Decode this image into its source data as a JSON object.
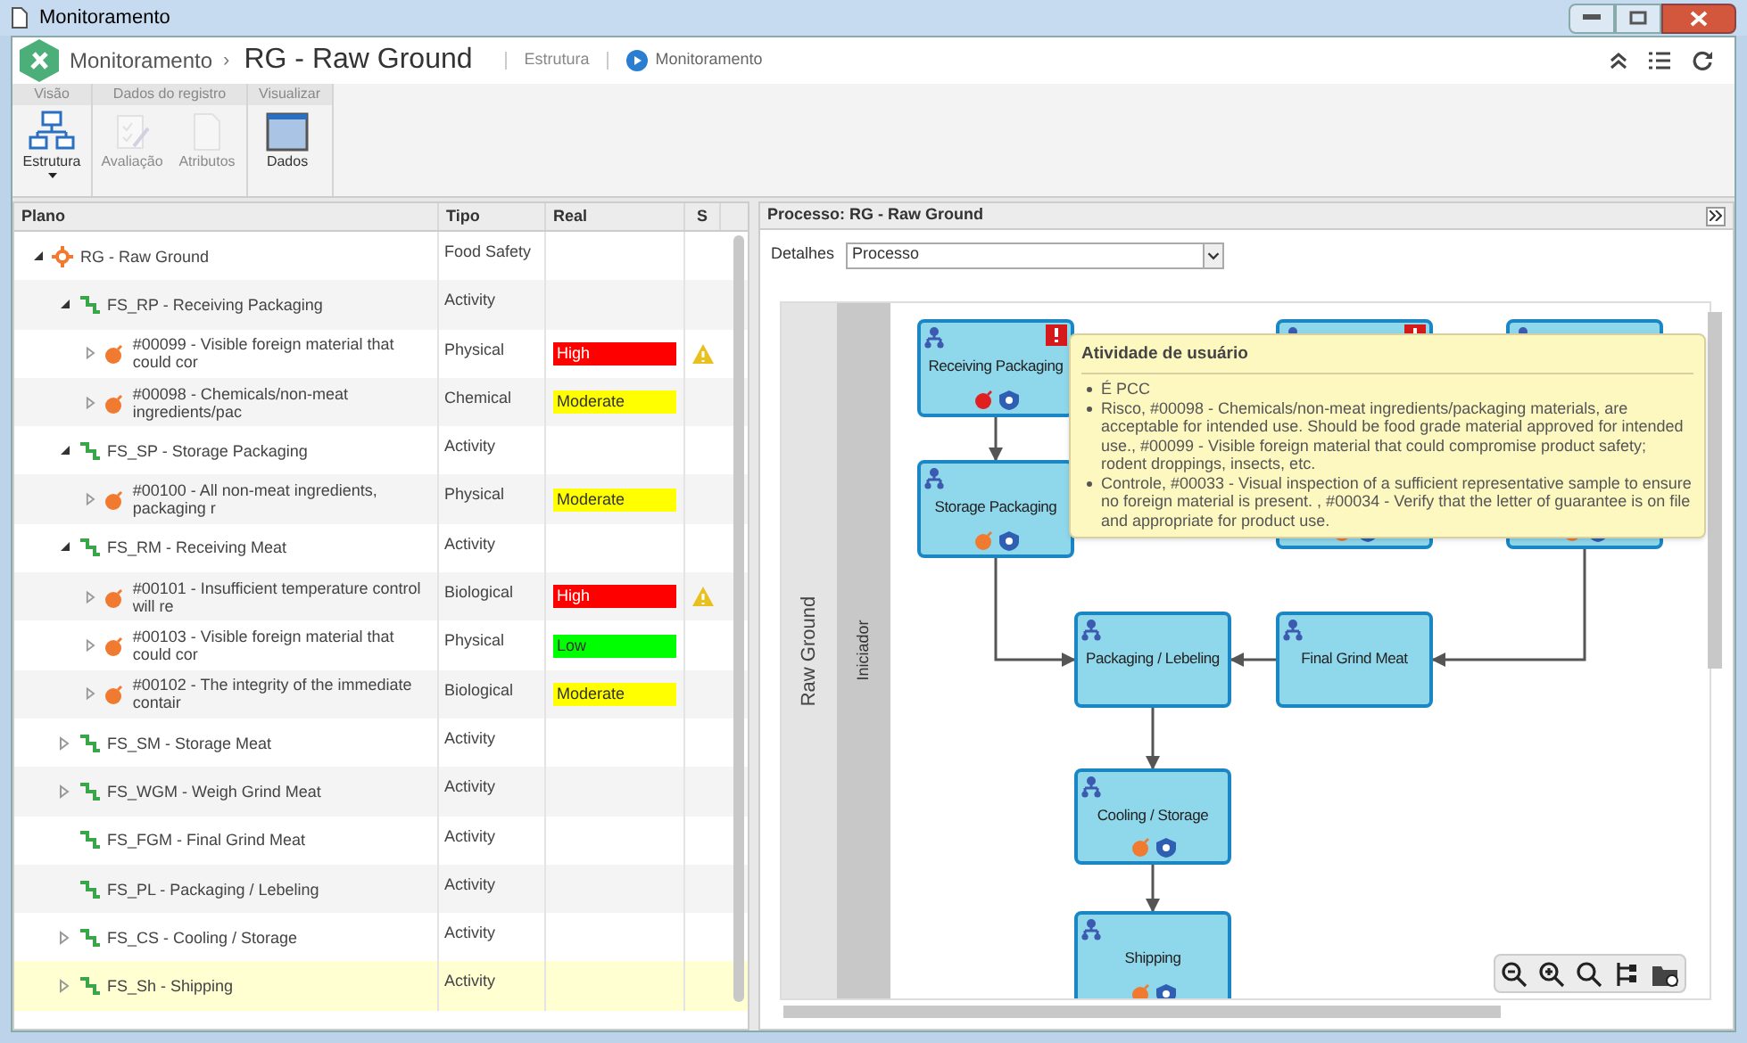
{
  "window": {
    "title": "Monitoramento"
  },
  "header": {
    "module": "Monitoramento",
    "separator": "›",
    "record": "RG - Raw Ground",
    "links": [
      {
        "label": "Estrutura",
        "current": false
      },
      {
        "label": "Monitoramento",
        "current": true
      }
    ]
  },
  "ribbon": {
    "groups": [
      {
        "label": "Visão",
        "buttons": [
          {
            "label": "Estrutura",
            "disabled": false,
            "dropdown": true
          }
        ]
      },
      {
        "label": "Dados do registro",
        "buttons": [
          {
            "label": "Avaliação",
            "disabled": true,
            "dropdown": false
          },
          {
            "label": "Atributos",
            "disabled": true,
            "dropdown": false
          }
        ]
      },
      {
        "label": "Visualizar",
        "buttons": [
          {
            "label": "Dados",
            "disabled": false,
            "dropdown": false
          }
        ]
      }
    ]
  },
  "tree": {
    "columns": [
      "Plano",
      "Tipo",
      "Real",
      "S"
    ],
    "rows": [
      {
        "kind": "process",
        "label": "RG - Raw Ground",
        "type": "Food Safety",
        "expanded": true,
        "selected": false,
        "children": [
          {
            "kind": "activity",
            "label": "FS_RP - Receiving Packaging",
            "type": "Activity",
            "expanded": true,
            "selected": false,
            "children": [
              {
                "kind": "risk",
                "label": "#00099 - Visible foreign material that could cor",
                "type": "Physical",
                "real": {
                  "label": "High",
                  "color": "#ff0000"
                },
                "alert": true,
                "expanded": false,
                "selected": false
              },
              {
                "kind": "risk",
                "label": "#00098 - Chemicals/non-meat ingredients/pac",
                "type": "Chemical",
                "real": {
                  "label": "Moderate",
                  "color": "#ffff00"
                },
                "alert": false,
                "expanded": false,
                "selected": false
              }
            ]
          },
          {
            "kind": "activity",
            "label": "FS_SP - Storage Packaging",
            "type": "Activity",
            "expanded": true,
            "selected": false,
            "children": [
              {
                "kind": "risk",
                "label": "#00100 - All non-meat ingredients, packaging r",
                "type": "Physical",
                "real": {
                  "label": "Moderate",
                  "color": "#ffff00"
                },
                "alert": false,
                "expanded": false,
                "selected": false
              }
            ]
          },
          {
            "kind": "activity",
            "label": "FS_RM - Receiving Meat",
            "type": "Activity",
            "expanded": true,
            "selected": false,
            "children": [
              {
                "kind": "risk",
                "label": "#00101 - Insufficient temperature control will re",
                "type": "Biological",
                "real": {
                  "label": "High",
                  "color": "#ff0000"
                },
                "alert": true,
                "expanded": false,
                "selected": false
              },
              {
                "kind": "risk",
                "label": "#00103 - Visible foreign material that could cor",
                "type": "Physical",
                "real": {
                  "label": "Low",
                  "color": "#00ff00"
                },
                "alert": false,
                "expanded": false,
                "selected": false
              },
              {
                "kind": "risk",
                "label": "#00102 - The integrity of the immediate contair",
                "type": "Biological",
                "real": {
                  "label": "Moderate",
                  "color": "#ffff00"
                },
                "alert": false,
                "expanded": false,
                "selected": false
              }
            ]
          },
          {
            "kind": "activity",
            "label": "FS_SM - Storage Meat",
            "type": "Activity",
            "expanded": false,
            "selected": false
          },
          {
            "kind": "activity",
            "label": "FS_WGM - Weigh Grind Meat",
            "type": "Activity",
            "expanded": false,
            "selected": false
          },
          {
            "kind": "activity",
            "label": "FS_FGM - Final Grind Meat",
            "type": "Activity",
            "selected": false
          },
          {
            "kind": "activity",
            "label": "FS_PL - Packaging / Lebeling",
            "type": "Activity",
            "selected": false
          },
          {
            "kind": "activity",
            "label": "FS_CS - Cooling / Storage",
            "type": "Activity",
            "expanded": false,
            "selected": false
          },
          {
            "kind": "activity",
            "label": "FS_Sh - Shipping",
            "type": "Activity",
            "expanded": false,
            "selected": true
          }
        ]
      }
    ]
  },
  "process_panel": {
    "title": "Processo: RG - Raw Ground",
    "details_label": "Detalhes",
    "details_value": "Processo",
    "lanes": [
      "Raw Ground",
      "Iniciador"
    ],
    "nodes": [
      {
        "label": "Receiving Packaging",
        "alert": true,
        "risk": true,
        "critical": true,
        "control": true
      },
      {
        "label": "Storage Packaging",
        "alert": false,
        "risk": true,
        "critical": false,
        "control": true
      },
      {
        "alert": true,
        "risk": true,
        "critical": false,
        "control": true
      },
      {
        "alert": false,
        "risk": true,
        "critical": false,
        "control": true
      },
      {
        "label": "Packaging / Lebeling",
        "alert": false,
        "risk": false,
        "control": false
      },
      {
        "label": "Final Grind Meat",
        "alert": false,
        "risk": false,
        "control": false
      },
      {
        "label": "Cooling / Storage",
        "alert": false,
        "risk": true,
        "critical": false,
        "control": true
      },
      {
        "label": "Shipping",
        "alert": false,
        "risk": true,
        "critical": false,
        "control": true
      }
    ],
    "tooltip": {
      "title": "Atividade de usuário",
      "items": [
        "É PCC",
        "Risco, #00098 - Chemicals/non-meat ingredients/packaging materials, are acceptable for intended use. Should be food grade material approved for intended use., #00099 - Visible foreign material that could compromise product safety; rodent droppings, insects, etc.",
        "Controle, #00033 - Visual inspection of a sufficient representative sample to ensure no foreign material is present. , #00034 - Verify that the letter of guarantee is on file and appropriate for product use."
      ]
    }
  }
}
